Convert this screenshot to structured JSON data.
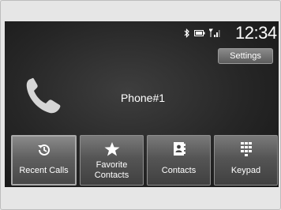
{
  "status_bar": {
    "time": "12:34",
    "icons": [
      "bluetooth-icon",
      "battery-icon",
      "signal-icon"
    ]
  },
  "header": {
    "settings_label": "Settings"
  },
  "main": {
    "phone_name": "Phone#1",
    "phone_icon": "phone-handset-icon"
  },
  "softkeys": [
    {
      "label": "Recent Calls",
      "icon": "recent-calls-icon",
      "selected": true
    },
    {
      "label": "Favorite\nContacts",
      "icon": "star-icon",
      "selected": false
    },
    {
      "label": "Contacts",
      "icon": "address-book-icon",
      "selected": false
    },
    {
      "label": "Keypad",
      "icon": "keypad-icon",
      "selected": false
    }
  ],
  "colors": {
    "screen_bg": "#262626",
    "button_bg": "#555555",
    "text": "#ffffff",
    "bezel": "#e6e6e6"
  }
}
